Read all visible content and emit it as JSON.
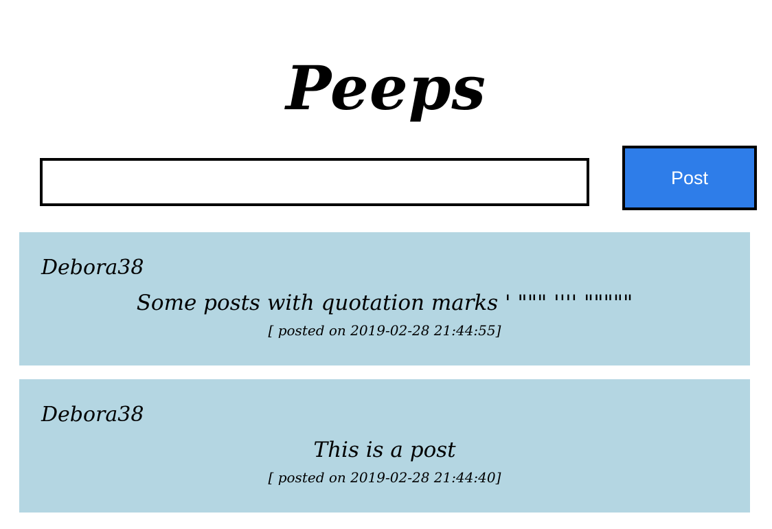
{
  "header": {
    "title": "Peeps"
  },
  "compose": {
    "input_value": "",
    "input_placeholder": "",
    "post_label": "Post"
  },
  "peeps": [
    {
      "author": "Debora38",
      "message": "Some posts with quotation marks ' \"\"\" '''' \"\"\"\"\"",
      "timestamp": "[ posted on 2019-02-28 21:44:55]"
    },
    {
      "author": "Debora38",
      "message": "This is a post",
      "timestamp": "[ posted on 2019-02-28 21:44:40]"
    }
  ],
  "colors": {
    "button": "#2e7de9",
    "peep_background": "#b4d6e2"
  }
}
